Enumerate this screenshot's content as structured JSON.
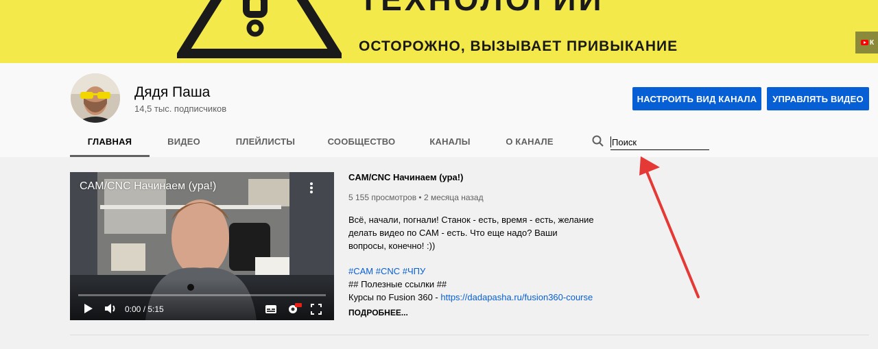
{
  "banner": {
    "headline": "ТЕХНОЛОГИИ",
    "tagline": "ОСТОРОЖНО, ВЫЗЫВАЕТ ПРИВЫКАНИЕ",
    "link_text": "К"
  },
  "channel": {
    "name": "Дядя Паша",
    "subscribers": "14,5 тыс. подписчиков"
  },
  "buttons": {
    "customize": "НАСТРОИТЬ ВИД КАНАЛА",
    "manage": "УПРАВЛЯТЬ ВИДЕО"
  },
  "tabs": [
    {
      "label": "ГЛАВНАЯ",
      "active": true
    },
    {
      "label": "ВИДЕО",
      "active": false
    },
    {
      "label": "ПЛЕЙЛИСТЫ",
      "active": false
    },
    {
      "label": "СООБЩЕСТВО",
      "active": false
    },
    {
      "label": "КАНАЛЫ",
      "active": false
    },
    {
      "label": "О КАНАЛЕ",
      "active": false
    }
  ],
  "search": {
    "placeholder": "Поиск",
    "value": ""
  },
  "featured_video": {
    "overlay_title": "CAM/CNC Начинаем (ура!)",
    "time": "0:00 / 5:15",
    "progress": 0,
    "title": "CAM/CNC Начинаем (ура!)",
    "meta": "5 155 просмотров • 2 месяца назад",
    "description": "Всё, начали, погнали! Станок - есть, время - есть, желание делать видео по CAM - есть. Что еще надо? Ваши вопросы, конечно! :))",
    "hashtags": "#CAM #CNC #ЧПУ",
    "links_heading": "## Полезные ссылки ##",
    "course_prefix": "Курсы по Fusion 360 - ",
    "course_link": "https://dadapasha.ru/fusion360-course",
    "more": "ПОДРОБНЕЕ..."
  },
  "colors": {
    "banner": "#f3e94a",
    "accent_blue": "#065fd4",
    "annotation_arrow": "#e53935"
  }
}
